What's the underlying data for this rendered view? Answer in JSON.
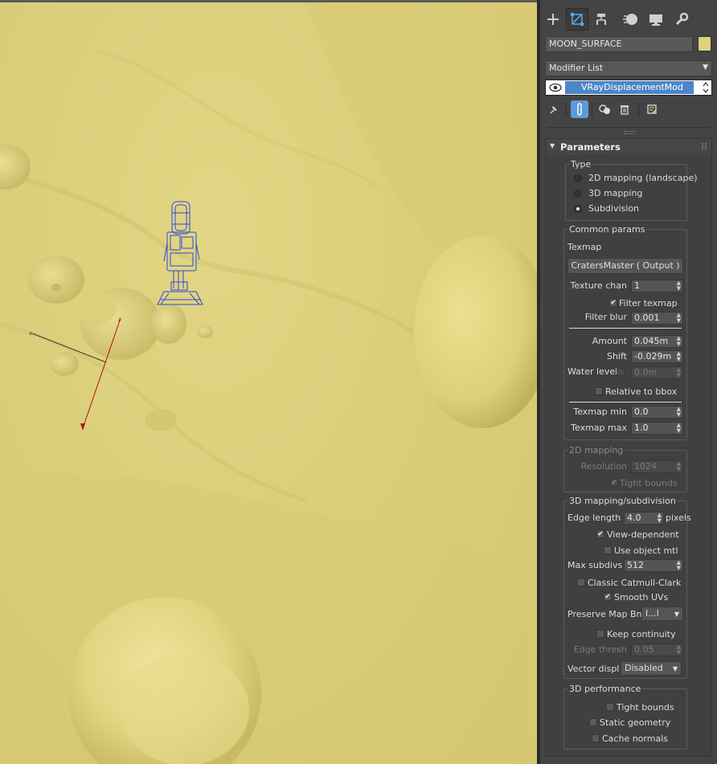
{
  "object": {
    "name": "MOON_SURFACE",
    "color": "#e0d27a"
  },
  "modifier_list": {
    "label": "Modifier List"
  },
  "stack": {
    "selected": "VRayDisplacementMod"
  },
  "rollout": {
    "title": "Parameters"
  },
  "type": {
    "title": "Type",
    "options": [
      "2D mapping (landscape)",
      "3D mapping",
      "Subdivision"
    ],
    "selected": "Subdivision"
  },
  "common": {
    "title": "Common params",
    "texmap_label": "Texmap",
    "texmap_button": "CratersMaster  ( Output )",
    "texture_chan_label": "Texture chan",
    "texture_chan": "1",
    "filter_texmap_label": "Filter texmap",
    "filter_blur_label": "Filter blur",
    "filter_blur": "0.001",
    "amount_label": "Amount",
    "amount": "0.045m",
    "shift_label": "Shift",
    "shift": "-0.029m",
    "water_level_label": "Water level",
    "water_level": "0.0m",
    "relative_bbox_label": "Relative to bbox",
    "texmap_min_label": "Texmap min",
    "texmap_min": "0.0",
    "texmap_max_label": "Texmap max",
    "texmap_max": "1.0"
  },
  "mapping2d": {
    "title": "2D mapping",
    "resolution_label": "Resolution",
    "resolution": "1024",
    "tight_bounds_label": "Tight bounds"
  },
  "mapping3d": {
    "title": "3D mapping/subdivision",
    "edge_length_label": "Edge length",
    "edge_length": "4.0",
    "pixels_label": "pixels",
    "view_dependent_label": "View-dependent",
    "use_object_mtl_label": "Use object mtl",
    "max_subdivs_label": "Max subdivs",
    "max_subdivs": "512",
    "classic_cc_label": "Classic Catmull-Clark",
    "smooth_uvs_label": "Smooth UVs",
    "preserve_map_label": "Preserve Map Bnd",
    "preserve_map_value": "I...l",
    "keep_continuity_label": "Keep continuity",
    "edge_thresh_label": "Edge thresh",
    "edge_thresh": "0.05",
    "vector_displ_label": "Vector displ",
    "vector_displ_value": "Disabled"
  },
  "perf": {
    "title": "3D performance",
    "tight_bounds_label": "Tight bounds",
    "static_geometry_label": "Static geometry",
    "cache_normals_label": "Cache normals"
  }
}
